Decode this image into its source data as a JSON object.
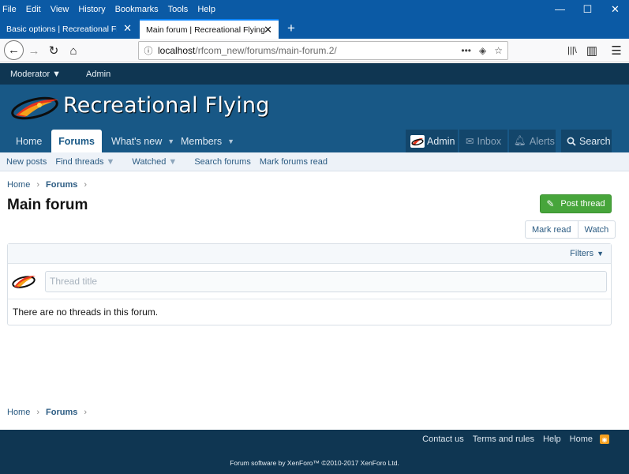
{
  "browser": {
    "menu": [
      "File",
      "Edit",
      "View",
      "History",
      "Bookmarks",
      "Tools",
      "Help"
    ],
    "window_controls": {
      "minimize": "—",
      "maximize": "☐",
      "close": "✕"
    },
    "tabs": [
      {
        "title": "Basic options | Recreational Flying -",
        "active": false
      },
      {
        "title": "Main forum | Recreational Flying",
        "active": true
      }
    ],
    "new_tab": "+",
    "url": {
      "host": "localhost",
      "path": "/rfcom_new/forums/main-forum.2/"
    },
    "url_actions": {
      "more": "•••",
      "pocket": "◈",
      "bookmark": "☆"
    },
    "nav_icons": {
      "back": "←",
      "forward": "→",
      "reload": "↻",
      "home": "⌂",
      "library": "|||\\",
      "sidebar": "▥",
      "menu": "☰"
    }
  },
  "staffbar": {
    "items": [
      "Moderator",
      "Admin"
    ]
  },
  "site": {
    "name": "Recreational Flying"
  },
  "nav": {
    "items": [
      {
        "label": "Home"
      },
      {
        "label": "Forums",
        "selected": true
      },
      {
        "label": "What's new"
      },
      {
        "label": "Members"
      }
    ],
    "user": {
      "admin": "Admin",
      "inbox": "Inbox",
      "alerts": "Alerts",
      "search": "Search"
    }
  },
  "subnav": {
    "items": [
      "New posts",
      "Find threads",
      "Watched",
      "Search forums",
      "Mark forums read"
    ]
  },
  "breadcrumb": [
    "Home",
    "Forums"
  ],
  "page": {
    "title": "Main forum",
    "post_thread": "Post thread",
    "mark_read": "Mark read",
    "watch": "Watch",
    "filters": "Filters",
    "thread_title_placeholder": "Thread title",
    "empty_message": "There are no threads in this forum."
  },
  "footer": {
    "links": [
      "Contact us",
      "Terms and rules",
      "Help",
      "Home"
    ],
    "copyright": "Forum software by XenForo™ ©2010-2017 XenForo Ltd."
  },
  "colors": {
    "brand": "#185886",
    "dark": "#0f3652",
    "accent_green": "#47a53b",
    "browser_blue": "#0b5aa5"
  }
}
